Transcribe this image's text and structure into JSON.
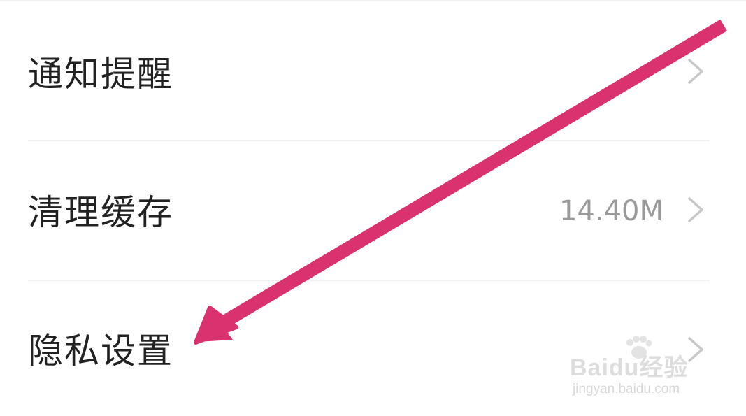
{
  "settings": {
    "items": [
      {
        "label": "通知提醒",
        "value": ""
      },
      {
        "label": "清理缓存",
        "value": "14.40M"
      },
      {
        "label": "隐私设置",
        "value": ""
      }
    ]
  },
  "annotation": {
    "arrow_color": "#d9326f",
    "points_to": "隐私设置"
  },
  "watermark": {
    "brand": "Baidu经验",
    "url": "jingyan.baidu.com"
  },
  "colors": {
    "label_text": "#222222",
    "value_text": "#9a9a9a",
    "chevron": "#c8c8c8",
    "divider": "#f0f0f0"
  }
}
